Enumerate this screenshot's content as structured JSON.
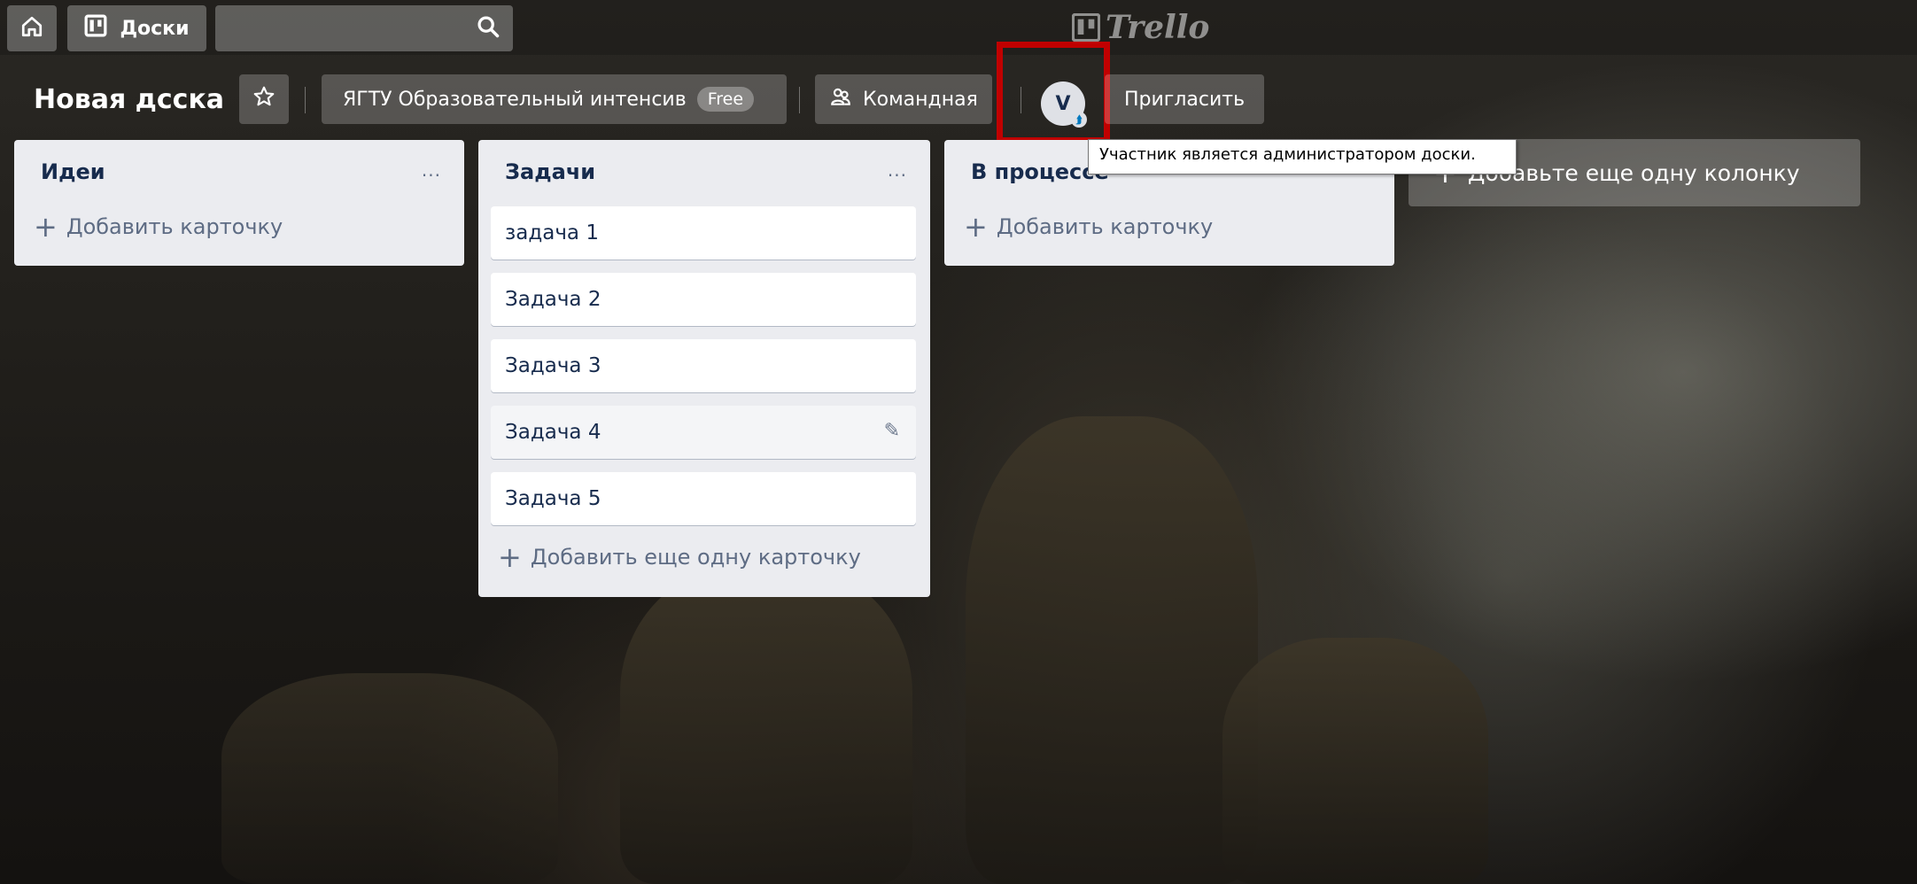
{
  "topbar": {
    "home_icon": "home-icon",
    "boards_label": "Доски",
    "search_icon": "search-icon",
    "logo_text": "Trello"
  },
  "board": {
    "title": "Новая дсска",
    "organization": "ЯГТУ Образовательный интенсив",
    "plan_badge": "Free",
    "visibility": "Командная",
    "member_initial": "V",
    "invite_label": "Пригласить",
    "tooltip": "Участник является администратором доски."
  },
  "lists": [
    {
      "title": "Идеи",
      "menu": "...",
      "cards": [],
      "add_label": "Добавить карточку"
    },
    {
      "title": "Задачи",
      "menu": "...",
      "cards": [
        "задача 1",
        "Задача 2",
        "Задача 3",
        "Задача 4",
        "Задача 5"
      ],
      "add_label": "Добавить еще одну карточку"
    },
    {
      "title": "В процессе",
      "menu": "",
      "cards": [],
      "add_label": "Добавить карточку"
    }
  ],
  "add_list_label": "Добавьте еще одну колонку"
}
